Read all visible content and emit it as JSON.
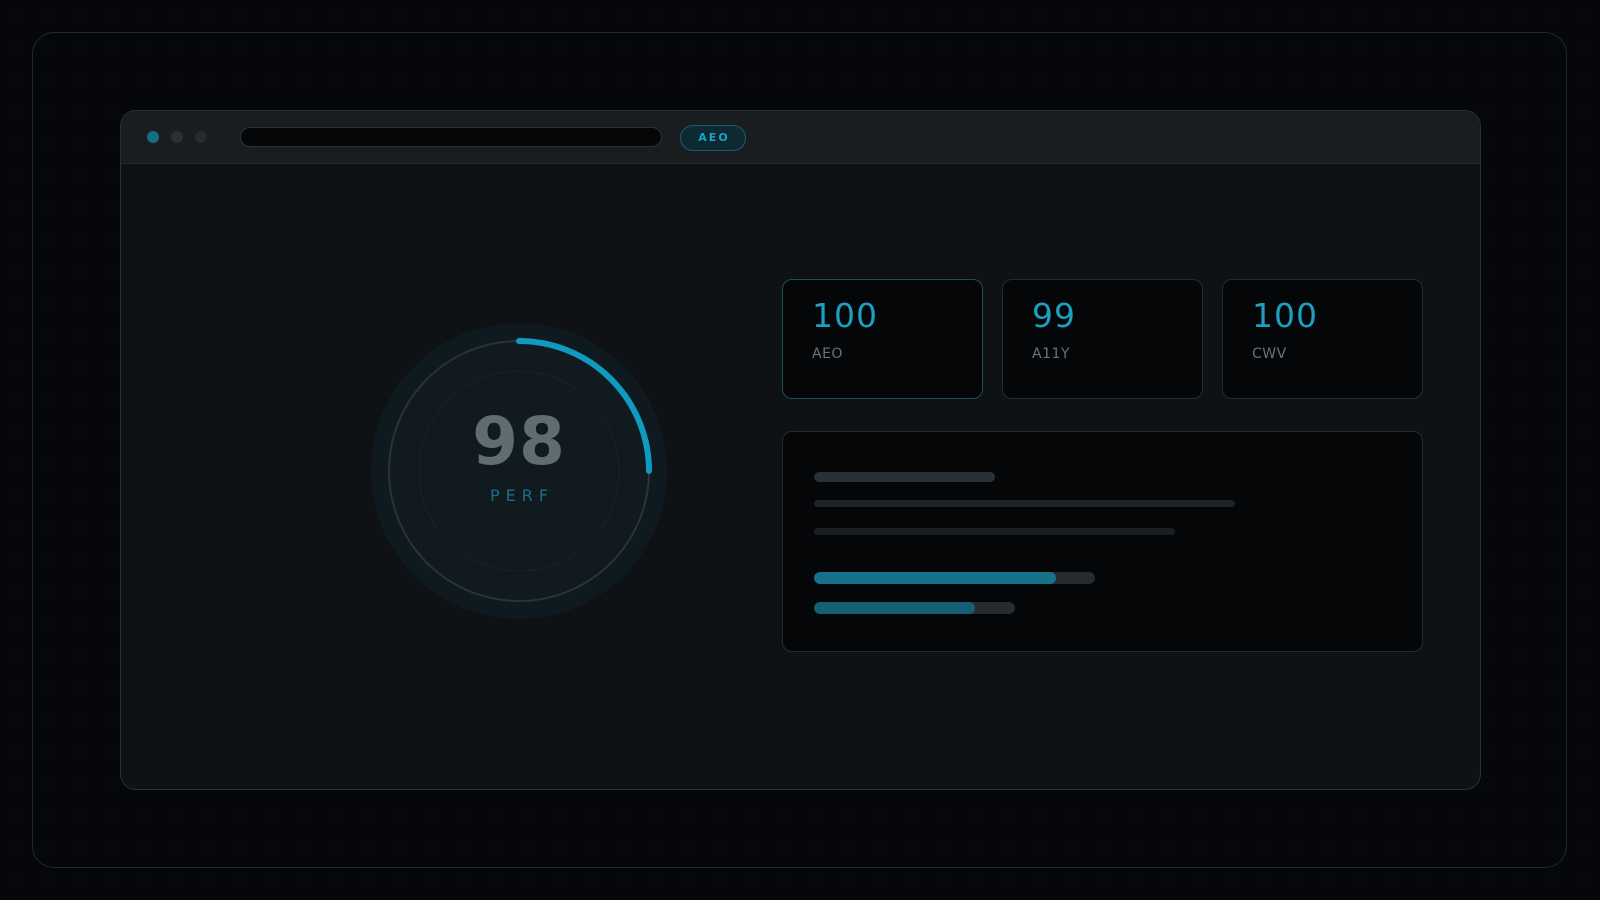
{
  "toolbar": {
    "tag_label": "AEO"
  },
  "gauge": {
    "value": "98",
    "label": "PERF",
    "arc_fraction": 0.25,
    "accent_color": "#0f9bc0"
  },
  "score_cards": [
    {
      "value": "100",
      "label": "AEO",
      "active": true
    },
    {
      "value": "99",
      "label": "A11Y",
      "active": false
    },
    {
      "value": "100",
      "label": "CWV",
      "active": false
    }
  ],
  "detail_panel": {
    "progress_bars": [
      {
        "fraction": 0.86,
        "color": "#16728a"
      },
      {
        "fraction": 0.8,
        "color": "#145f73"
      }
    ]
  },
  "colors": {
    "accent": "#1d9fc0",
    "background": "#05070a",
    "window": "#0f1215"
  },
  "icons": {
    "window_dots": [
      "window-close-dot-icon",
      "window-minimize-dot-icon",
      "window-maximize-dot-icon"
    ]
  }
}
